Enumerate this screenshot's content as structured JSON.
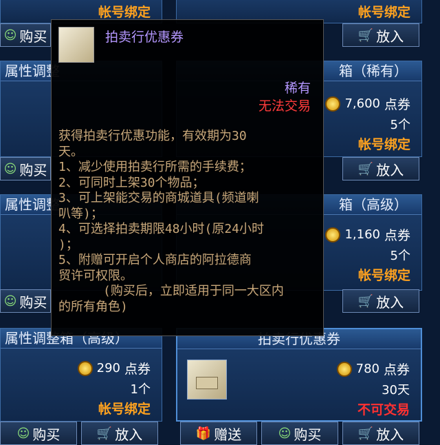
{
  "cards": [
    {
      "title": "",
      "price": "",
      "unit": "",
      "qty": "",
      "bind": "帐号绑定"
    },
    {
      "title": "",
      "price": "",
      "unit": "",
      "qty": "",
      "bind": "帐号绑定"
    },
    {
      "title": "属性调整",
      "price": "",
      "unit": "",
      "qty": "",
      "bind": ""
    },
    {
      "title": "箱（稀有）",
      "price": "7,600",
      "unit": "点券",
      "qty": "5个",
      "bind": "帐号绑定"
    },
    {
      "title": "属性调整",
      "price": "",
      "unit": "",
      "qty": "",
      "bind": ""
    },
    {
      "title": "箱（高级）",
      "price": "1,160",
      "unit": "点券",
      "qty": "5个",
      "bind": "帐号绑定"
    },
    {
      "title": "属性调整箱（高级）",
      "price": "290",
      "unit": "点券",
      "qty": "1个",
      "bind": "帐号绑定"
    },
    {
      "title": "拍卖行优惠券",
      "price": "780",
      "unit": "点券",
      "qty": "30天",
      "bind": "不可交易"
    }
  ],
  "buttons": {
    "buy": "购买",
    "put": "放入",
    "gift": "赠送"
  },
  "tooltip": {
    "name": "拍卖行优惠券",
    "rarity": "稀有",
    "trade": "无法交易",
    "desc": "获得拍卖行优惠功能，有效期为30\n天。\n1、减少使用拍卖行所需的手续费；\n2、可同时上架30个物品；\n3、可上架能交易的商城道具(频道喇\n叭等)；\n4、可选择拍卖期限48小时(原24小时\n)；\n5、附赠可开启个人商店的阿拉德商\n贸许可权限。\n      (购买后，立即适用于同一大区内\n的所有角色)"
  },
  "colors": {
    "accent": "#ffa21f",
    "untradable": "#ff3131",
    "rare": "#b497ff"
  },
  "icons": {
    "buy": "buy-icon",
    "put": "cart-icon",
    "gift": "gift-icon",
    "coin": "coin-icon"
  }
}
